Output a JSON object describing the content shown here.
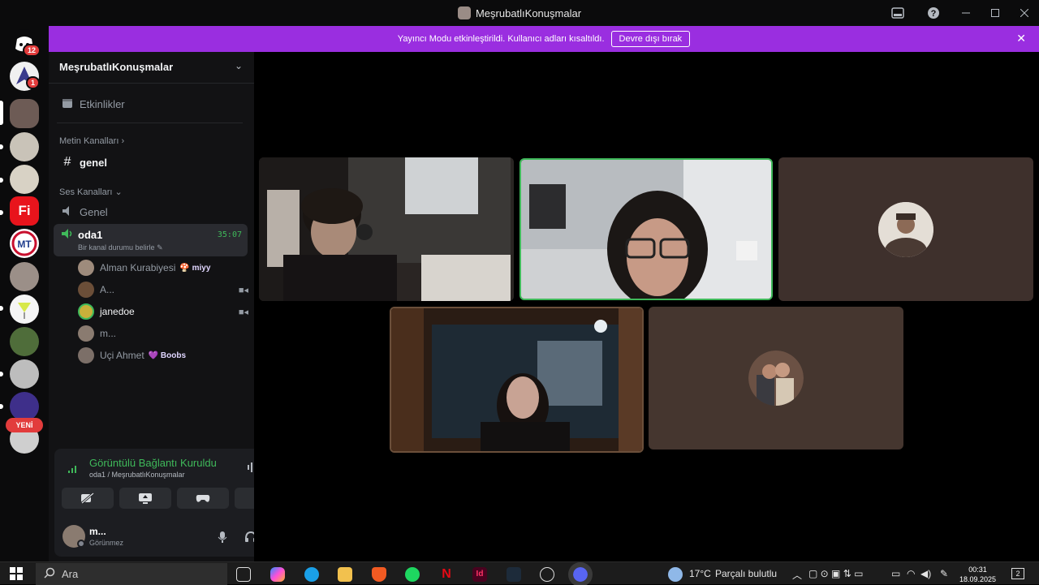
{
  "window": {
    "title": "MeşrubatlıKonuşmalar",
    "controls": [
      "inbox-icon",
      "help-icon",
      "minimize-icon",
      "maximize-icon",
      "close-icon"
    ]
  },
  "banner": {
    "text": "Yayıncı Modu etkinleştirildi. Kullanıcı adları kısaltıldı.",
    "button": "Devre dışı bırak"
  },
  "servers": {
    "dm_badge": "12",
    "badge2": "1",
    "new_label": "YENİ"
  },
  "sidebar": {
    "server_name": "MeşrubatlıKonuşmalar",
    "events": "Etkinlikler",
    "text_category": "Metin Kanalları",
    "text_channel": "genel",
    "voice_category": "Ses Kanalları",
    "voice_channel_1": "Genel",
    "active_channel": {
      "name": "oda1",
      "status": "Bir kanal durumu belirle",
      "time": "35:07"
    },
    "members": [
      {
        "name": "Alman Kurabiyesi",
        "tag": "miyy",
        "cam": false
      },
      {
        "name": "A...",
        "tag": "",
        "cam": true
      },
      {
        "name": "janedoe",
        "tag": "",
        "cam": true
      },
      {
        "name": "m...",
        "tag": "",
        "cam": false
      },
      {
        "name": "Uçi Ahmet",
        "tag": "Boobs",
        "cam": false
      }
    ]
  },
  "voice_panel": {
    "status": "Görüntülü Bağlantı Kuruldu",
    "location": "oda1 / MeşrubatlıKonuşmalar"
  },
  "user": {
    "name": "m...",
    "status": "Görünmez"
  },
  "taskbar": {
    "search": "Ara",
    "weather_temp": "17°C",
    "weather_text": "Parçalı bulutlu",
    "time": "00:31",
    "date": "18.09.2025",
    "notif_count": "2"
  }
}
